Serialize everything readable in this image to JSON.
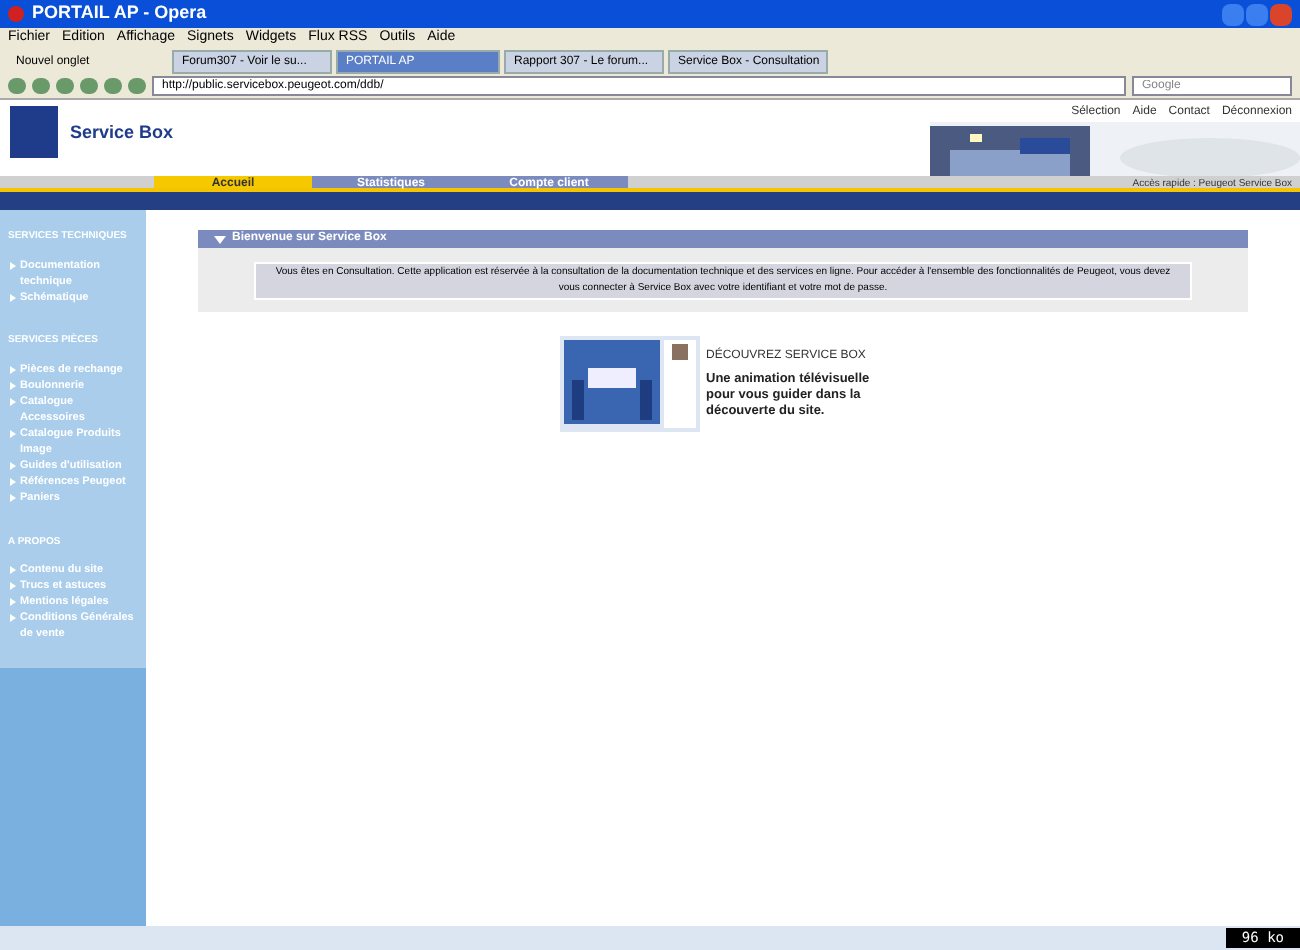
{
  "window": {
    "title": "PORTAIL AP - Opera"
  },
  "menu": [
    "Fichier",
    "Edition",
    "Affichage",
    "Signets",
    "Widgets",
    "Flux RSS",
    "Outils",
    "Aide"
  ],
  "tabs": [
    {
      "label": "Nouvel onglet",
      "selected": false
    },
    {
      "label": "Forum307 - Voir le su...",
      "selected": false
    },
    {
      "label": "PORTAIL AP",
      "selected": true
    },
    {
      "label": "Rapport 307 - Le forum...",
      "selected": false
    },
    {
      "label": "Service Box - Consultation",
      "selected": false
    }
  ],
  "address": "http://public.servicebox.peugeot.com/ddb/",
  "search": {
    "placeholder": "Google"
  },
  "site": {
    "brand": "Service Box",
    "top_links": [
      "Sélection",
      "Aide",
      "Contact",
      "Déconnexion"
    ],
    "nav": [
      {
        "label": "Accueil",
        "selected": true
      },
      {
        "label": "Statistiques",
        "selected": false
      },
      {
        "label": "Compte client",
        "selected": false
      }
    ],
    "nav_info": "Accès rapide : Peugeot Service Box"
  },
  "sidebar": [
    {
      "heading": "SERVICES TECHNIQUES",
      "items": [
        "Documentation technique",
        "Schématique"
      ]
    },
    {
      "heading": "SERVICES PIÈCES",
      "items": [
        "Pièces de rechange",
        "Boulonnerie",
        "Catalogue Accessoires",
        "Catalogue Produits Image",
        "Guides d'utilisation",
        "Références Peugeot",
        "Paniers"
      ]
    },
    {
      "heading": "A PROPOS",
      "items": [
        "Contenu du site",
        "Trucs et astuces",
        "Mentions légales",
        "Conditions Générales de vente"
      ]
    }
  ],
  "welcome": {
    "title": "Bienvenue sur Service Box",
    "message": "Vous êtes en Consultation. Cette application est réservée à la consultation de la documentation technique et des services en ligne. Pour accéder à l'ensemble des fonctionnalités de Peugeot, vous devez vous connecter à Service Box avec votre identifiant et votre mot de passe."
  },
  "promo": {
    "title": "DÉCOUVREZ SERVICE BOX",
    "text": "Une animation télévisuelle pour vous guider dans la découverte du site."
  },
  "status": "96 ko"
}
